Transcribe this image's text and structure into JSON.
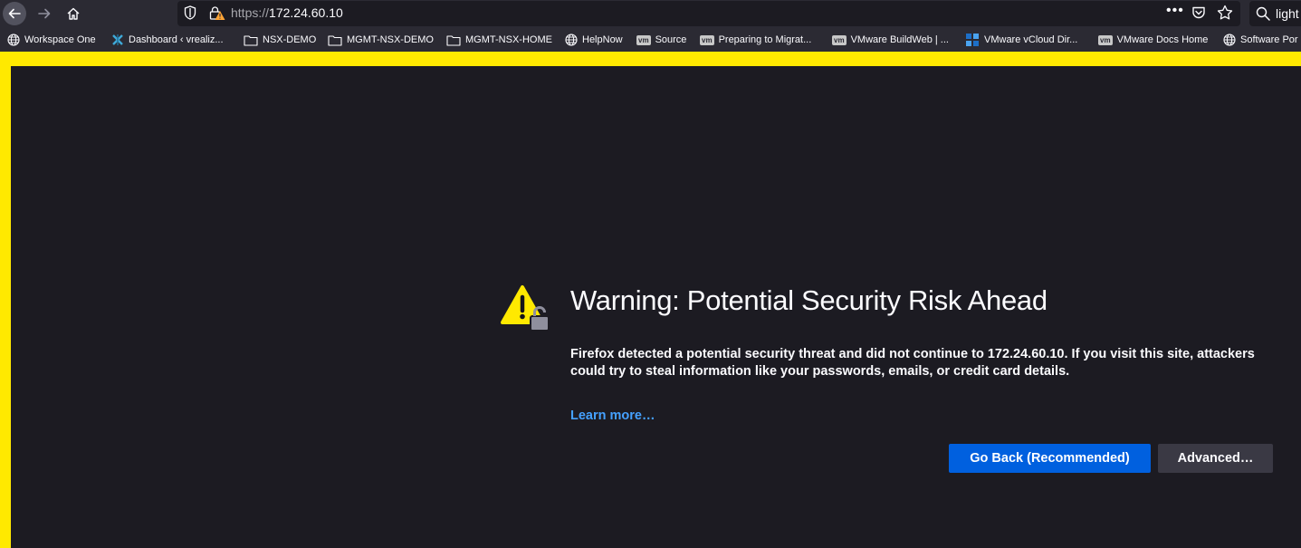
{
  "urlbar": {
    "scheme": "https://",
    "host": "172.24.60.10"
  },
  "search": {
    "text": "light"
  },
  "bookmarks": [
    {
      "label": "Workspace One",
      "icon": "globe-icon"
    },
    {
      "label": "Dashboard ‹ vrealiz...",
      "icon": "vrealize-icon"
    },
    {
      "label": "NSX-DEMO",
      "icon": "folder-icon"
    },
    {
      "label": "MGMT-NSX-DEMO",
      "icon": "folder-icon"
    },
    {
      "label": "MGMT-NSX-HOME",
      "icon": "folder-icon"
    },
    {
      "label": "HelpNow",
      "icon": "globe-icon"
    },
    {
      "label": "Source",
      "icon": "vm-icon"
    },
    {
      "label": "Preparing to Migrat...",
      "icon": "vm-icon"
    },
    {
      "label": "VMware BuildWeb | ...",
      "icon": "vm-icon"
    },
    {
      "label": "VMware vCloud Dir...",
      "icon": "vcloud-icon"
    },
    {
      "label": "VMware Docs Home",
      "icon": "vm-icon"
    },
    {
      "label": "Software Por",
      "icon": "globe-icon"
    }
  ],
  "vm_badge": "vm",
  "warning": {
    "title": "Warning: Potential Security Risk Ahead",
    "description": "Firefox detected a potential security threat and did not continue to 172.24.60.10. If you visit this site, attackers could try to steal information like your passwords, emails, or credit card details.",
    "learn_more": "Learn more…",
    "go_back_label": "Go Back (Recommended)",
    "advanced_label": "Advanced…"
  },
  "colors": {
    "frame": "#ffe900",
    "background": "#1c1b22",
    "primary_button": "#0060df",
    "link": "#45a1ff"
  }
}
